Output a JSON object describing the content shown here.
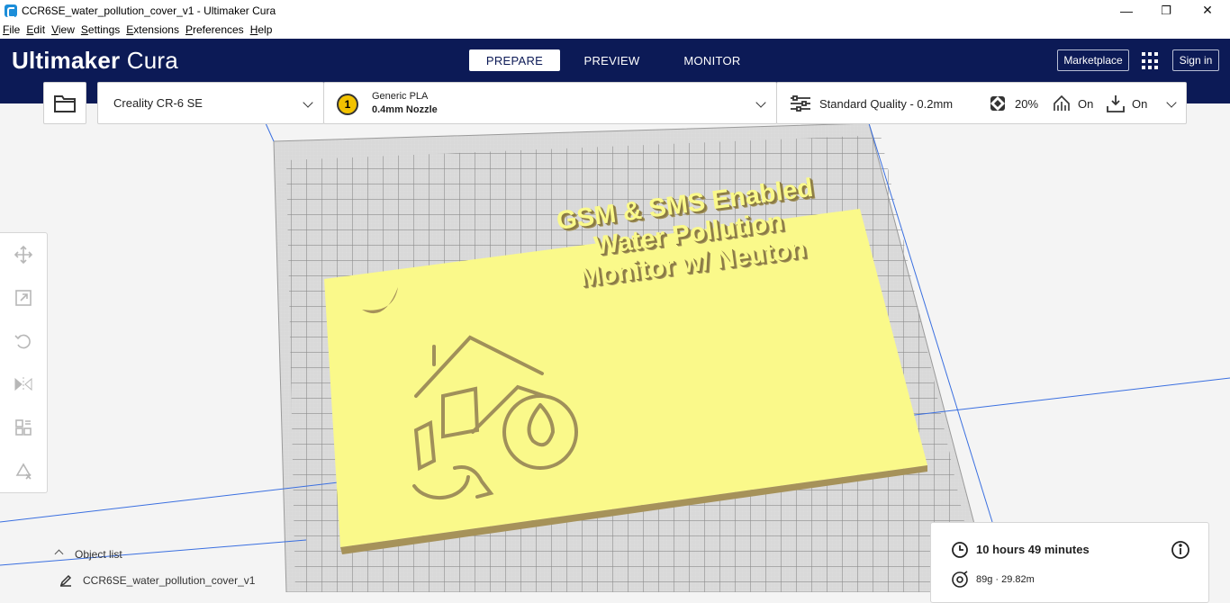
{
  "window": {
    "title": "CCR6SE_water_pollution_cover_v1 - Ultimaker Cura",
    "minimize_glyph": "—",
    "maximize_glyph": "❐",
    "close_glyph": "✕"
  },
  "menu": {
    "items": [
      {
        "label": "File",
        "key": "F",
        "rest": "ile"
      },
      {
        "label": "Edit",
        "key": "E",
        "rest": "dit"
      },
      {
        "label": "View",
        "key": "V",
        "rest": "iew"
      },
      {
        "label": "Settings",
        "key": "S",
        "rest": "ettings"
      },
      {
        "label": "Extensions",
        "key": "E",
        "rest": "xtensions"
      },
      {
        "label": "Preferences",
        "key": "P",
        "rest": "references"
      },
      {
        "label": "Help",
        "key": "H",
        "rest": "elp"
      }
    ]
  },
  "header": {
    "brand_bold": "Ultimaker",
    "brand_light": " Cura",
    "tabs": [
      {
        "label": "PREPARE",
        "active": true
      },
      {
        "label": "PREVIEW",
        "active": false
      },
      {
        "label": "MONITOR",
        "active": false
      }
    ],
    "marketplace_label": "Marketplace",
    "signin_label": "Sign in"
  },
  "toolbar": {
    "machine_name": "Creality CR-6 SE",
    "extruder_number": "1",
    "material_name": "Generic PLA",
    "nozzle": "0.4mm Nozzle",
    "quality_profile": "Standard Quality - 0.2mm",
    "infill": "20%",
    "support": "On",
    "adhesion": "On"
  },
  "model": {
    "line1": "GSM & SMS Enabled",
    "line2": "Water Pollution",
    "line3": "Monitor w/ Neuton",
    "color": "#faf98a"
  },
  "object_list": {
    "toggle_label": "Object list",
    "file_name": "CCR6SE_water_pollution_cover_v1"
  },
  "print_summary": {
    "time": "10 hours 49 minutes",
    "material": "89g · 29.82m"
  },
  "colors": {
    "header_bg": "#0c1a56",
    "accent": "#196ef0"
  }
}
